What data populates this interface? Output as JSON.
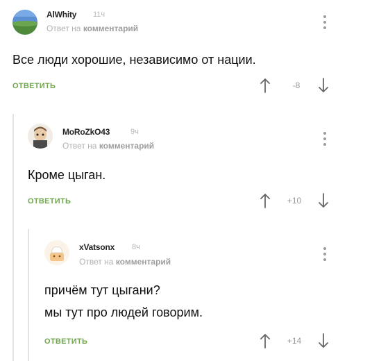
{
  "comments": [
    {
      "username": "AlWhity",
      "time": "11ч",
      "reply_prefix": "Ответ на",
      "reply_link": "комментарий",
      "text_lines": [
        "Все люди хорошие, независимо от нации."
      ],
      "reply_label": "ОТВЕТИТЬ",
      "score": "-8"
    },
    {
      "username": "MoRoZkO43",
      "time": "9ч",
      "reply_prefix": "Ответ на",
      "reply_link": "комментарий",
      "text_lines": [
        "Кроме цыган."
      ],
      "reply_label": "ОТВЕТИТЬ",
      "score": "+10"
    },
    {
      "username": "xVatsonx",
      "time": "8ч",
      "reply_prefix": "Ответ на",
      "reply_link": "комментарий",
      "text_lines": [
        "причём тут цыгани?",
        "мы тут про людей говорим."
      ],
      "reply_label": "ОТВЕТИТЬ",
      "score": "+14"
    }
  ],
  "colors": {
    "accent_green": "#6ea74a",
    "muted_text": "#b0b0b0",
    "thread_line": "#e3e3e3"
  },
  "icons": [
    "kebab-menu-icon",
    "arrow-up-icon",
    "arrow-down-icon"
  ]
}
